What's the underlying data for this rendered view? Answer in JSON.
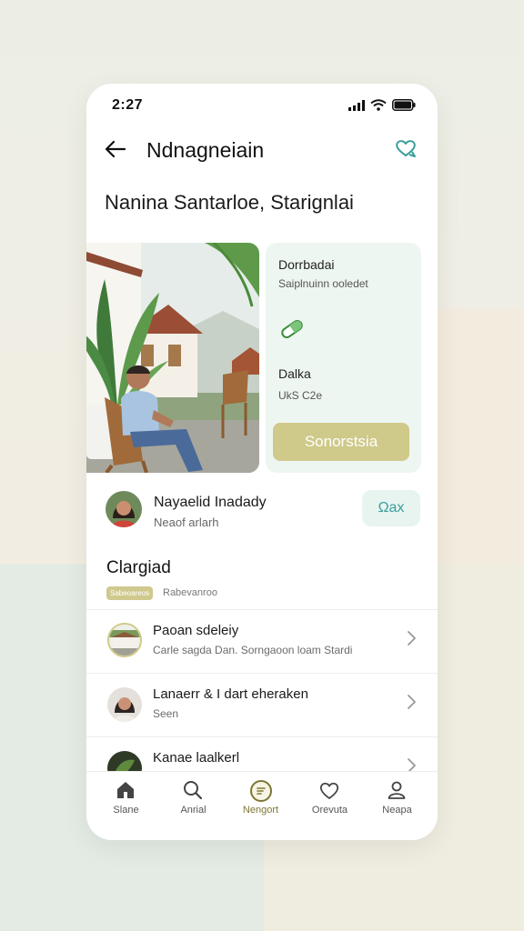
{
  "status": {
    "time": "2:27"
  },
  "header": {
    "title": "Ndnagneiain"
  },
  "subtitle": "Nanina Santarloe, Starignlai",
  "info_card": {
    "label_1": "Dorrbadai",
    "sub_1": "Saiplnuinn ooledet",
    "label_2": "Dalka",
    "sub_2": "UkS C2e",
    "button_label": "Sonorstsia"
  },
  "profile": {
    "name": "Nayaelid Inadady",
    "sub": "Neaof arlarh",
    "chat_label": "Ωax"
  },
  "section": {
    "title": "Clargiad",
    "tag": "Sabeoareos",
    "tag_text": "Rabevanroo"
  },
  "list": [
    {
      "title": "Paoan sdeleiy",
      "sub": "Carle sagda  Dan. Sorngaoon loam Stardi"
    },
    {
      "title": "Lanaerr & I dart eheraken",
      "sub": "Seen"
    },
    {
      "title": "Kanae laalkerl",
      "sub": ""
    }
  ],
  "tabs": [
    {
      "label": "Slane",
      "icon": "home-icon"
    },
    {
      "label": "Anrial",
      "icon": "search-icon"
    },
    {
      "label": "Nengort",
      "icon": "chat-bubble-icon"
    },
    {
      "label": "Orevuta",
      "icon": "heart-icon"
    },
    {
      "label": "Neapa",
      "icon": "person-icon"
    }
  ],
  "colors": {
    "accent_olive": "#cfc98a",
    "accent_teal": "#3b9e9a",
    "card_mint": "#eef6f1",
    "active_tab": "#7f7632"
  }
}
